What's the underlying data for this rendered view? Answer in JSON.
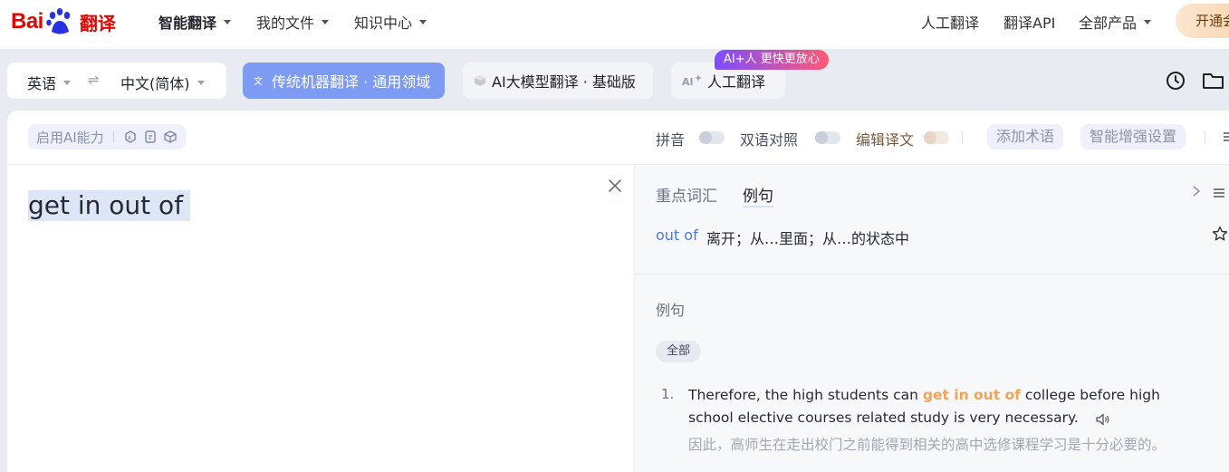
{
  "logo": {
    "bai": "Bai",
    "du": "du",
    "product": "翻译"
  },
  "nav": {
    "items": [
      {
        "label": "智能翻译",
        "has_caret": true,
        "active": true
      },
      {
        "label": "我的文件",
        "has_caret": true
      },
      {
        "label": "知识中心",
        "has_caret": true
      }
    ],
    "right": [
      {
        "label": "人工翻译"
      },
      {
        "label": "翻译API"
      },
      {
        "label": "全部产品",
        "has_caret": true
      }
    ],
    "vip_label": "开通会员"
  },
  "lang": {
    "source": "英语",
    "target": "中文(简体)",
    "swap_glyph": "⇌"
  },
  "modes": {
    "machine": {
      "label": "传统机器翻译 · 通用领域"
    },
    "ai": {
      "label": "AI大模型翻译 · 基础版"
    },
    "human": {
      "label": "人工翻译"
    },
    "badge": "AI+人 更快更放心"
  },
  "toolbar": {
    "ai_capability": "启用AI能力",
    "pinyin": "拼音",
    "bilingual": "双语对照",
    "edit": "编辑译文",
    "add_term": "添加术语",
    "enhance": "智能增强设置"
  },
  "source_text": "get in out of",
  "result": {
    "tabs": [
      "重点词汇",
      "例句"
    ],
    "vocab": [
      {
        "word": "out of",
        "definition": "离开；从…里面；从…的状态中"
      }
    ],
    "examples_title": "例句",
    "filter_chip": "全部",
    "examples": [
      {
        "num": "1.",
        "en_before": "Therefore, the high students can ",
        "en_highlight": "get in out of",
        "en_after": " college before high school elective courses related study is very necessary.",
        "zh": "因此，高师生在走出校门之前能得到相关的高中选修课程学习是十分必要的。"
      }
    ]
  },
  "colors": {
    "brand_red": "#e10601",
    "brand_blue": "#2932e1",
    "accent": "#7d9bf3",
    "highlight": "#f0a45a"
  }
}
